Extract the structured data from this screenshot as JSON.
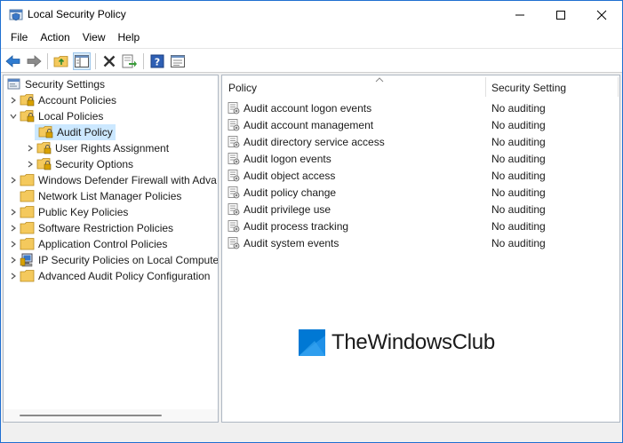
{
  "window": {
    "title": "Local Security Policy",
    "accent_color": "#1f6fd1"
  },
  "menu": [
    "File",
    "Action",
    "View",
    "Help"
  ],
  "toolbar": {
    "buttons": [
      "back-arrow-icon",
      "forward-arrow-icon",
      "up-folder-icon",
      "show-hide-tree-icon",
      "delete-icon",
      "export-list-icon",
      "help-icon",
      "properties-icon"
    ]
  },
  "tree": {
    "root": "Security Settings",
    "items": [
      {
        "label": "Account Policies",
        "expanded": false,
        "level": 1
      },
      {
        "label": "Local Policies",
        "expanded": true,
        "level": 1
      },
      {
        "label": "Audit Policy",
        "expanded": false,
        "level": 2,
        "selected": true
      },
      {
        "label": "User Rights Assignment",
        "expanded": false,
        "level": 2
      },
      {
        "label": "Security Options",
        "expanded": false,
        "level": 2
      },
      {
        "label": "Windows Defender Firewall with Adva",
        "expanded": false,
        "level": 1
      },
      {
        "label": "Network List Manager Policies",
        "expanded": false,
        "level": 1
      },
      {
        "label": "Public Key Policies",
        "expanded": false,
        "level": 1
      },
      {
        "label": "Software Restriction Policies",
        "expanded": false,
        "level": 1
      },
      {
        "label": "Application Control Policies",
        "expanded": false,
        "level": 1
      },
      {
        "label": "IP Security Policies on Local Compute",
        "expanded": false,
        "level": 1
      },
      {
        "label": "Advanced Audit Policy Configuration",
        "expanded": false,
        "level": 1
      }
    ]
  },
  "list": {
    "columns": {
      "policy": "Policy",
      "setting": "Security Setting"
    },
    "rows": [
      {
        "policy": "Audit account logon events",
        "setting": "No auditing"
      },
      {
        "policy": "Audit account management",
        "setting": "No auditing"
      },
      {
        "policy": "Audit directory service access",
        "setting": "No auditing"
      },
      {
        "policy": "Audit logon events",
        "setting": "No auditing"
      },
      {
        "policy": "Audit object access",
        "setting": "No auditing"
      },
      {
        "policy": "Audit policy change",
        "setting": "No auditing"
      },
      {
        "policy": "Audit privilege use",
        "setting": "No auditing"
      },
      {
        "policy": "Audit process tracking",
        "setting": "No auditing"
      },
      {
        "policy": "Audit system events",
        "setting": "No auditing"
      }
    ]
  },
  "watermark": {
    "text": "TheWindowsClub",
    "logo_color": "#0078d4"
  },
  "colors": {
    "selection": "#cce8ff",
    "folder": "#f4c95d",
    "lock": "#d8a100"
  }
}
